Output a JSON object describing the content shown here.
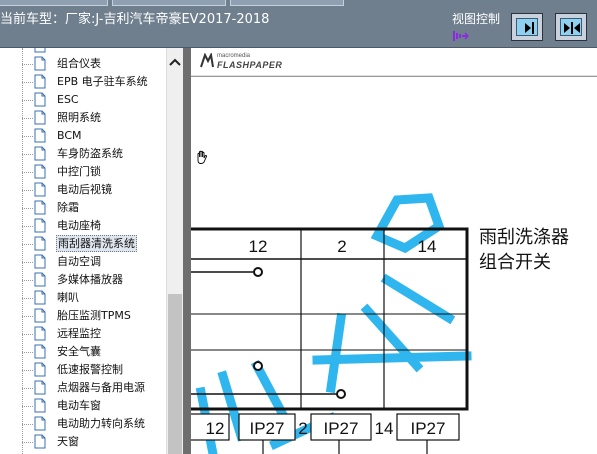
{
  "header": {
    "title": "当前车型：厂家:J-吉利汽车帝豪EV2017-2018",
    "view_control_label": "视图控制"
  },
  "tree": {
    "items": [
      {
        "label": "组合仪表",
        "selected": false
      },
      {
        "label": "EPB 电子驻车系统",
        "selected": false
      },
      {
        "label": "ESC",
        "selected": false
      },
      {
        "label": "照明系统",
        "selected": false
      },
      {
        "label": "BCM",
        "selected": false
      },
      {
        "label": "车身防盗系统",
        "selected": false
      },
      {
        "label": "中控门锁",
        "selected": false
      },
      {
        "label": "电动后视镜",
        "selected": false
      },
      {
        "label": "除霜",
        "selected": false
      },
      {
        "label": "电动座椅",
        "selected": false
      },
      {
        "label": "雨刮器清洗系统",
        "selected": true
      },
      {
        "label": "自动空调",
        "selected": false
      },
      {
        "label": "多媒体播放器",
        "selected": false
      },
      {
        "label": "喇叭",
        "selected": false
      },
      {
        "label": "胎压监测TPMS",
        "selected": false
      },
      {
        "label": "远程监控",
        "selected": false
      },
      {
        "label": "安全气囊",
        "selected": false
      },
      {
        "label": "低速报警控制",
        "selected": false
      },
      {
        "label": "点烟器与备用电源",
        "selected": false
      },
      {
        "label": "电动车窗",
        "selected": false
      },
      {
        "label": "电动助力转向系统",
        "selected": false
      },
      {
        "label": "天窗",
        "selected": false
      }
    ]
  },
  "flashpaper": {
    "brand_small": "macromedia",
    "brand_big": "FLASHPAPER"
  },
  "diagram": {
    "pin_headers": [
      "12",
      "2",
      "14"
    ],
    "component_title_line1": "雨刮洗涤器",
    "component_title_line2": "组合开关",
    "connector_labels": [
      {
        "pin": "12",
        "connector": "IP27"
      },
      {
        "pin": "2",
        "connector": "IP27"
      },
      {
        "pin": "14",
        "connector": "IP27"
      }
    ],
    "watermark_color": "#2fb6ee"
  },
  "colors": {
    "header_bg": "#6f7f8e",
    "view_button_inner": "#8fd0ee",
    "selected_bg": "#dfe6ee"
  }
}
